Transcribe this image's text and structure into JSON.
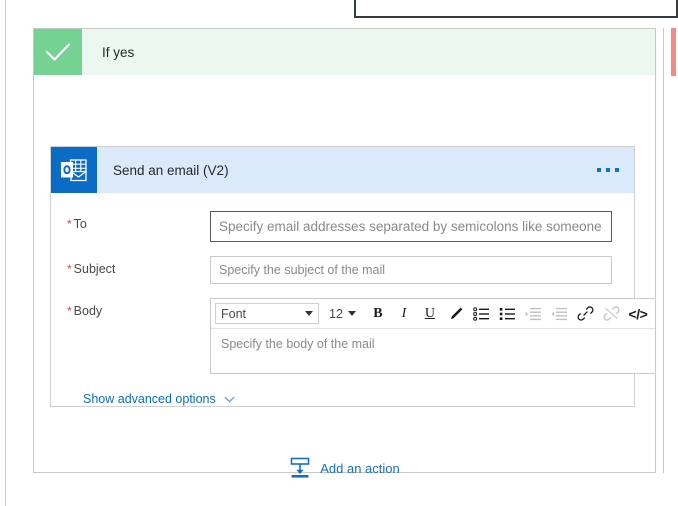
{
  "branch": {
    "icon": "checkmark-icon",
    "title": "If yes"
  },
  "action_card": {
    "app_icon": "outlook-icon",
    "title": "Send an email (V2)",
    "menu_icon": "ellipsis-icon",
    "fields": [
      {
        "label": "To",
        "required_marker": "*",
        "placeholder": "Specify email addresses separated by semicolons like someone@contoso.com",
        "value": ""
      },
      {
        "label": "Subject",
        "required_marker": "*",
        "placeholder": "Specify the subject of the mail",
        "value": ""
      },
      {
        "label": "Body",
        "required_marker": "*",
        "placeholder": "Specify the body of the mail",
        "value": ""
      }
    ],
    "editor_toolbar": {
      "font_label": "Font",
      "font_size": "12",
      "buttons": [
        {
          "name": "bold-icon",
          "glyph": "B",
          "enabled": true
        },
        {
          "name": "italic-icon",
          "glyph": "I",
          "enabled": true
        },
        {
          "name": "underline-icon",
          "glyph": "U",
          "enabled": true
        },
        {
          "name": "text-color-pen-icon",
          "glyph": "",
          "enabled": true
        },
        {
          "name": "bulleted-list-icon",
          "glyph": "",
          "enabled": true
        },
        {
          "name": "numbered-list-icon",
          "glyph": "",
          "enabled": true
        },
        {
          "name": "indent-increase-icon",
          "glyph": "",
          "enabled": false
        },
        {
          "name": "indent-decrease-icon",
          "glyph": "",
          "enabled": false
        },
        {
          "name": "link-icon",
          "glyph": "",
          "enabled": true
        },
        {
          "name": "unlink-icon",
          "glyph": "",
          "enabled": false
        },
        {
          "name": "code-view-icon",
          "glyph": "</>",
          "enabled": true
        }
      ]
    },
    "advanced_options": {
      "label": "Show advanced options",
      "icon": "chevron-down-icon"
    }
  },
  "add_action": {
    "label": "Add an action",
    "icon": "insert-action-icon"
  },
  "colors": {
    "branch_yes_green": "#74d293",
    "branch_yes_header_bg": "#ecf7ef",
    "branch_no_red": "#f08c84",
    "card_header_bg": "#dbeafa",
    "outlook_blue": "#0a6cc4",
    "link_blue": "#1a6fc4",
    "required_red": "#e04343"
  }
}
